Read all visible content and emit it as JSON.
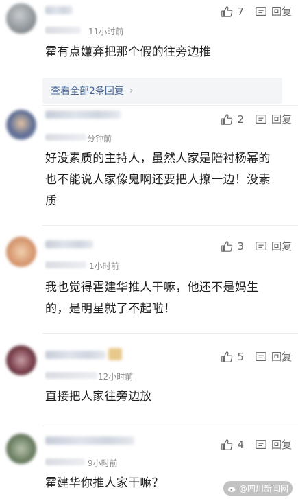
{
  "comments": [
    {
      "likes": "7",
      "reply_label": "回复",
      "time_suffix": "11小时前",
      "text": "霍有点嫌弃把那个假的往旁边推",
      "more_replies": "查看全部2条回复",
      "avatar_color": "#9aa0a6"
    },
    {
      "likes": "2",
      "reply_label": "回复",
      "time_suffix": "分钟前",
      "text": "好没素质的主持人，虽然人家是陪衬杨幂的也不能说人家像鬼啊还要把人撩一边！没素质",
      "avatar_color": "#6b7a9c"
    },
    {
      "likes": "3",
      "reply_label": "回复",
      "time_suffix": "1小时前",
      "text": "我也觉得霍建华推人干嘛，他还不是妈生的，是明星就了不起啦！",
      "avatar_color": "#d9a37b"
    },
    {
      "likes": "5",
      "reply_label": "回复",
      "time_suffix": "12小时前",
      "text": "直接把人家往旁边放",
      "avatar_color": "#8a5a62"
    },
    {
      "likes": "4",
      "reply_label": "回复",
      "time_suffix": "9小时前",
      "text": "霍建华你推人家干嘛？",
      "avatar_color": "#8fa38c"
    }
  ],
  "watermark": {
    "text": "@四川新闻网"
  },
  "icons": {
    "like": "thumbs-up-icon",
    "reply": "reply-icon",
    "chevron": "chevron-right-icon"
  }
}
